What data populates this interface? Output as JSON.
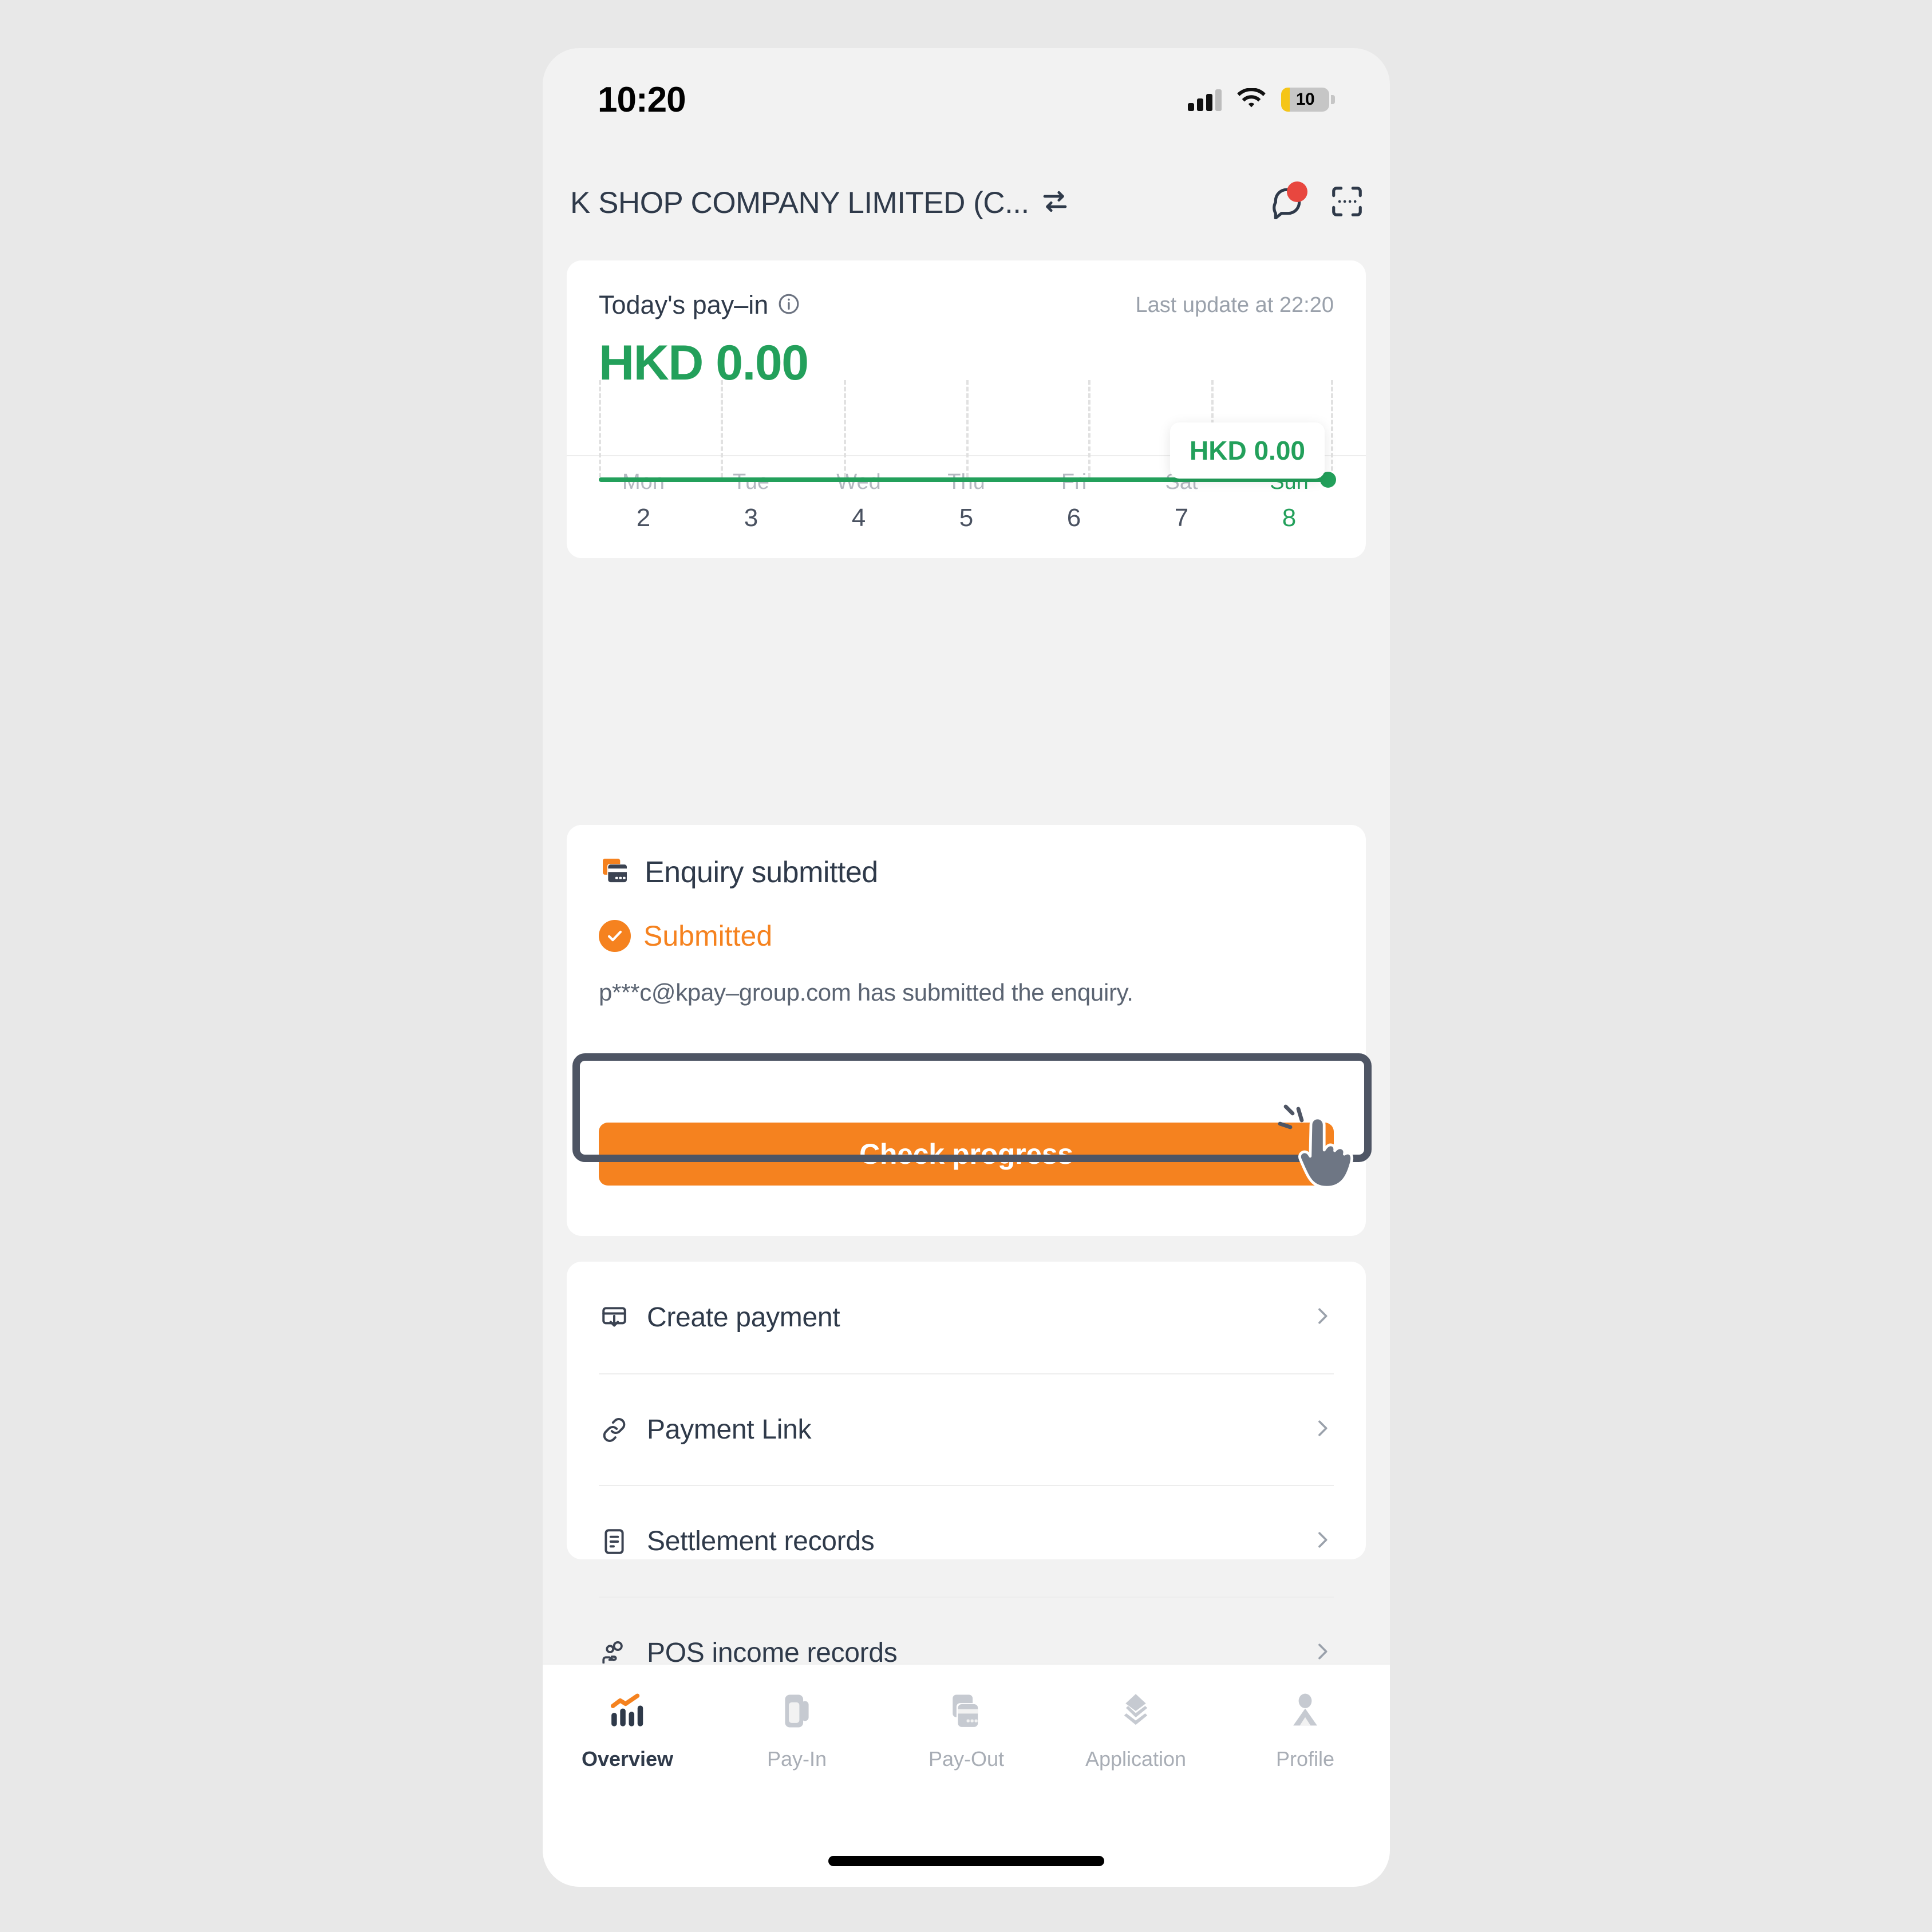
{
  "status_bar": {
    "time": "10:20",
    "battery_level": "10",
    "signal_icon": "signal-bars-icon",
    "wifi_icon": "wifi-icon",
    "battery_icon": "battery-icon"
  },
  "header": {
    "merchant_name": "K SHOP COMPANY LIMITED (C...",
    "switch_icon": "switch-account-icon",
    "chat_icon": "chat-bubble-icon",
    "scan_icon": "scan-qr-icon",
    "has_notification": true
  },
  "payin_card": {
    "label": "Today's pay–in",
    "info_icon": "info-icon",
    "last_update": "Last update at 22:20",
    "amount": "HKD 0.00",
    "accent_color": "#23a05b"
  },
  "chart_data": {
    "type": "line",
    "title": "Today's pay-in",
    "categories": [
      "Mon",
      "Tue",
      "Wed",
      "Thu",
      "Fri",
      "Sat",
      "Sun"
    ],
    "day_numbers": [
      "2",
      "3",
      "4",
      "5",
      "6",
      "7",
      "8"
    ],
    "values": [
      0,
      0,
      0,
      0,
      0,
      0,
      0
    ],
    "active_index": 6,
    "tooltip": "HKD 0.00",
    "ylim": [
      0,
      0
    ],
    "xlabel": "",
    "ylabel": "",
    "grid": true,
    "legend": "none",
    "series_color": "#23a05b"
  },
  "enquiry_card": {
    "title": "Enquiry submitted",
    "title_icon": "card-terminal-icon",
    "status_label": "Submitted",
    "status_icon": "check-circle-icon",
    "status_color": "#f5821f",
    "description": "p***c@kpay–group.com has submitted the enquiry.",
    "cta_label": "Check progress",
    "cta_color": "#f5821f"
  },
  "menu": {
    "items": [
      {
        "label": "Create payment",
        "icon": "create-payment-icon"
      },
      {
        "label": "Payment Link",
        "icon": "link-icon"
      },
      {
        "label": "Settlement records",
        "icon": "document-icon"
      },
      {
        "label": "POS income records",
        "icon": "hand-coin-icon"
      }
    ],
    "chevron_icon": "chevron-right-icon"
  },
  "bottom_nav": {
    "items": [
      {
        "label": "Overview",
        "icon": "chart-bars-icon",
        "active": true
      },
      {
        "label": "Pay-In",
        "icon": "payin-terminal-icon",
        "active": false
      },
      {
        "label": "Pay-Out",
        "icon": "payout-terminal-icon",
        "active": false
      },
      {
        "label": "Application",
        "icon": "layers-icon",
        "active": false
      },
      {
        "label": "Profile",
        "icon": "person-icon",
        "active": false
      }
    ]
  },
  "annotation": {
    "highlight_color": "#4e5564",
    "cursor_icon": "pointing-hand-cursor"
  }
}
